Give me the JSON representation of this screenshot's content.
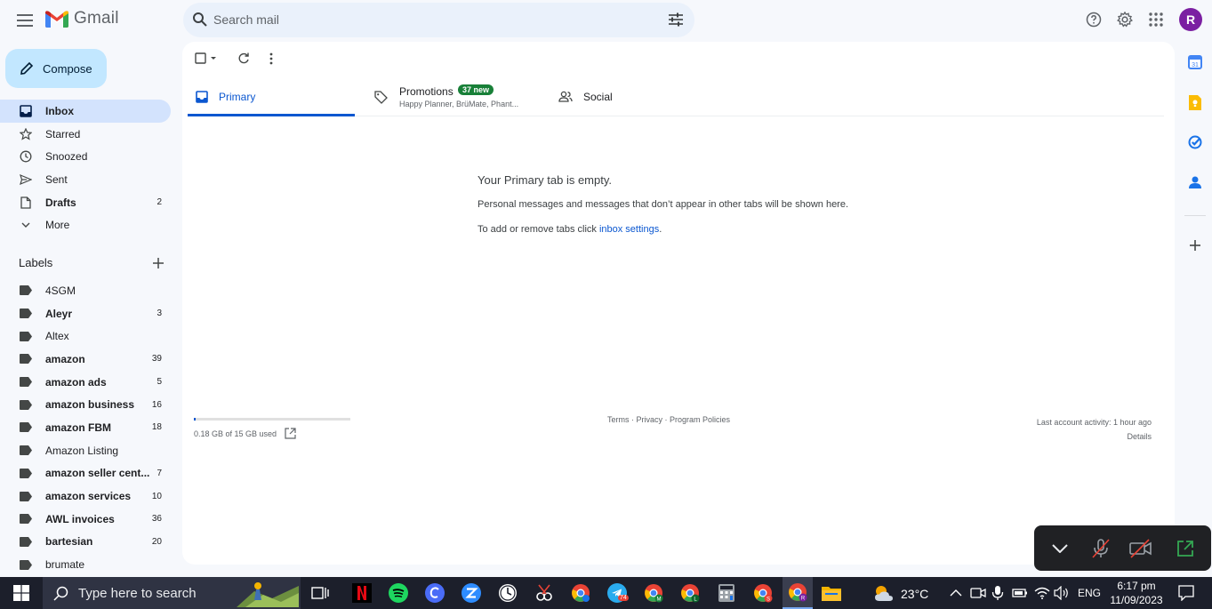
{
  "app": {
    "name": "Gmail"
  },
  "search": {
    "placeholder": "Search mail"
  },
  "account": {
    "initial": "R"
  },
  "compose": {
    "label": "Compose"
  },
  "nav": [
    {
      "label": "Inbox",
      "count": "",
      "icon": "inbox-icon",
      "active": true,
      "bold": true
    },
    {
      "label": "Starred",
      "count": "",
      "icon": "star-icon"
    },
    {
      "label": "Snoozed",
      "count": "",
      "icon": "clock-icon"
    },
    {
      "label": "Sent",
      "count": "",
      "icon": "send-icon"
    },
    {
      "label": "Drafts",
      "count": "2",
      "icon": "draft-icon",
      "bold": true
    },
    {
      "label": "More",
      "count": "",
      "icon": "chevron-down-icon"
    }
  ],
  "labels": {
    "heading": "Labels",
    "items": [
      {
        "label": "4SGM",
        "count": ""
      },
      {
        "label": "Aleyr",
        "count": "3",
        "bold": true
      },
      {
        "label": "Altex",
        "count": ""
      },
      {
        "label": "amazon",
        "count": "39",
        "bold": true
      },
      {
        "label": "amazon ads",
        "count": "5",
        "bold": true
      },
      {
        "label": "amazon business",
        "count": "16",
        "bold": true
      },
      {
        "label": "amazon FBM",
        "count": "18",
        "bold": true
      },
      {
        "label": "Amazon Listing",
        "count": ""
      },
      {
        "label": "amazon seller cent...",
        "count": "7",
        "bold": true
      },
      {
        "label": "amazon services",
        "count": "10",
        "bold": true
      },
      {
        "label": "AWL invoices",
        "count": "36",
        "bold": true
      },
      {
        "label": "bartesian",
        "count": "20",
        "bold": true
      },
      {
        "label": "brumate",
        "count": ""
      }
    ]
  },
  "tabs": {
    "primary": "Primary",
    "promotions": "Promotions",
    "promotions_badge": "37 new",
    "promotions_snippet": "Happy Planner, BrüMate, Phant...",
    "social": "Social"
  },
  "empty": {
    "title": "Your Primary tab is empty.",
    "description": "Personal messages and messages that don’t appear in other tabs will be shown here.",
    "settings_prefix": "To add or remove tabs click ",
    "settings_link": "inbox settings",
    "settings_suffix": "."
  },
  "footer": {
    "storage_text": "0.18 GB of 15 GB used",
    "storage_fraction": 0.012,
    "terms": "Terms",
    "privacy": "Privacy",
    "policies": "Program Policies",
    "separator": " · ",
    "activity": "Last account activity: 1 hour ago",
    "details": "Details"
  },
  "taskbar": {
    "search_placeholder": "Type here to search",
    "weather": "23°C",
    "language": "ENG",
    "time": "6:17 pm",
    "date": "11/09/2023",
    "telegram_badge": "74"
  },
  "colors": {
    "accent": "#0b57d0",
    "compose_bg": "#c2e7ff",
    "active_nav": "#d3e3fd",
    "badge_green": "#188038"
  }
}
